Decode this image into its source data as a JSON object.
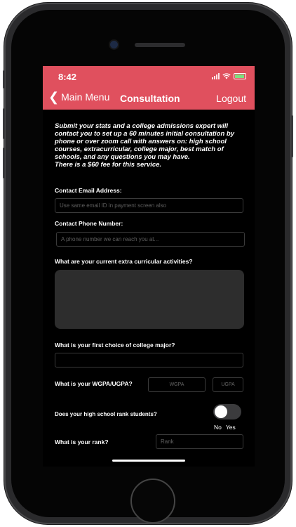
{
  "status_bar": {
    "time": "8:42"
  },
  "nav": {
    "back_label": "Main Menu",
    "title": "Consultation",
    "logout_label": "Logout"
  },
  "intro": {
    "text": "Submit your stats and a college admissions expert will contact you to set up a 60 minutes initial consultation by phone or over zoom call with answers on: high school courses, extracurricular, college major, best match of schools, and any questions you may have.",
    "fee": "There is a $60 fee for this service."
  },
  "form": {
    "email": {
      "label": "Contact Email Address:",
      "placeholder": "Use same email ID in payment screen also",
      "value": ""
    },
    "phone": {
      "label": "Contact Phone Number:",
      "placeholder": "A phone number we can reach you at...",
      "value": ""
    },
    "activities": {
      "label": "What are your current extra curricular activities?",
      "value": ""
    },
    "major": {
      "label": "What is your first choice of college major?",
      "value": ""
    },
    "gpa": {
      "label": "What is your WGPA/UGPA?",
      "wgpa_placeholder": "WGPA",
      "ugpa_placeholder": "UGPA"
    },
    "rank_toggle": {
      "label": "Does your high school rank students?",
      "no_label": "No",
      "yes_label": "Yes",
      "value": "No"
    },
    "rank": {
      "label": "What is your rank?",
      "placeholder": "Rank"
    }
  },
  "colors": {
    "header": "#e0505e",
    "background": "#000000",
    "field_border": "#3a3a3a",
    "textarea": "#2d2d2d"
  }
}
